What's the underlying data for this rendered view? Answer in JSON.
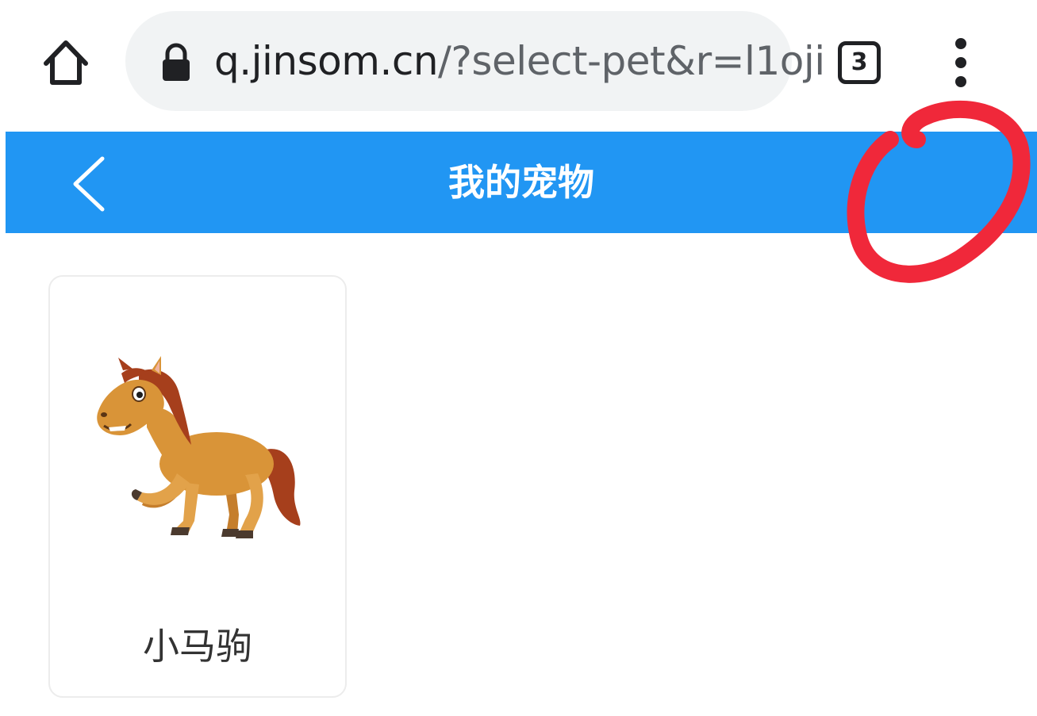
{
  "browser": {
    "url_host": "q.jinsom.cn",
    "url_rest": "/?select-pet&r=l1oji",
    "tab_count": "3",
    "icons": {
      "home": "home-icon",
      "lock": "lock-icon",
      "menu": "more-vert-icon"
    }
  },
  "header": {
    "title": "我的宠物",
    "background_color": "#2196f3",
    "back_icon": "chevron-left-icon"
  },
  "pets": [
    {
      "name": "小马驹",
      "image": "horse-illustration"
    }
  ],
  "annotation": {
    "color": "#f0283a",
    "shape": "red-hand-drawn-circle"
  }
}
